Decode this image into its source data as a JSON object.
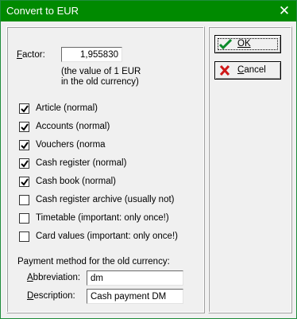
{
  "window": {
    "title": "Convert to EUR"
  },
  "factor": {
    "label": "Factor:",
    "value": "1,955830",
    "hint_line1": "(the value of 1 EUR",
    "hint_line2": "in the old currency)"
  },
  "options": [
    {
      "label": "Article (normal)",
      "checked": true
    },
    {
      "label": "Accounts (normal)",
      "checked": true
    },
    {
      "label": "Vouchers (norma",
      "checked": true
    },
    {
      "label": "Cash register (normal)",
      "checked": true
    },
    {
      "label": "Cash book (normal)",
      "checked": true
    },
    {
      "label": "Cash register archive (usually not)",
      "checked": false
    },
    {
      "label": "Timetable (important: only once!)",
      "checked": false
    },
    {
      "label": "Card values (important: only once!)",
      "checked": false
    }
  ],
  "payment": {
    "heading": "Payment method for the old currency:",
    "abbreviation_label": "Abbreviation:",
    "abbreviation_value": "dm",
    "description_label": "Description:",
    "description_value": "Cash payment DM"
  },
  "buttons": {
    "ok": "OK",
    "cancel": "Cancel"
  },
  "colors": {
    "titlebar": "#008a00",
    "ok_check": "#0a8a2a",
    "cancel_x": "#d01818"
  }
}
